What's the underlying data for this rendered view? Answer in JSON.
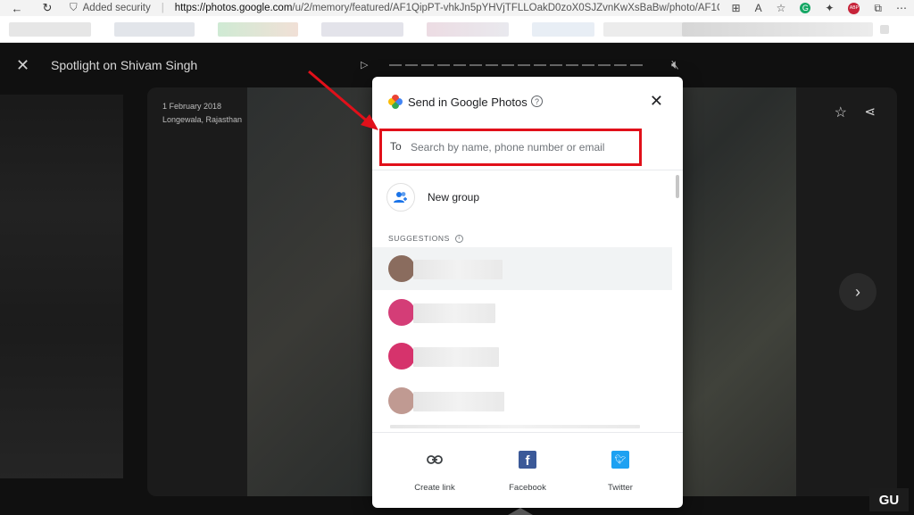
{
  "browser": {
    "security_label": "Added security",
    "url_host": "https://photos.google.com",
    "url_path": "/u/2/memory/featured/AF1QipPT-vhkJn5pYHVjTFLLOakD0zoX0SJZvnKwXsBaBw/photo/AF1QipPOv..."
  },
  "viewer": {
    "title": "Spotlight on Shivam Singh",
    "date": "1 February 2018",
    "place": "Longewala, Rajasthan"
  },
  "modal": {
    "title": "Send in Google Photos",
    "to_label": "To",
    "to_placeholder": "Search by name, phone number or email",
    "new_group_label": "New group",
    "suggestions_label": "SUGGESTIONS",
    "share": [
      {
        "label": "Create link"
      },
      {
        "label": "Facebook"
      },
      {
        "label": "Twitter"
      }
    ]
  },
  "colors": {
    "highlight_box": "#e1101a",
    "facebook": "#3b5998",
    "twitter": "#1da1f2"
  }
}
